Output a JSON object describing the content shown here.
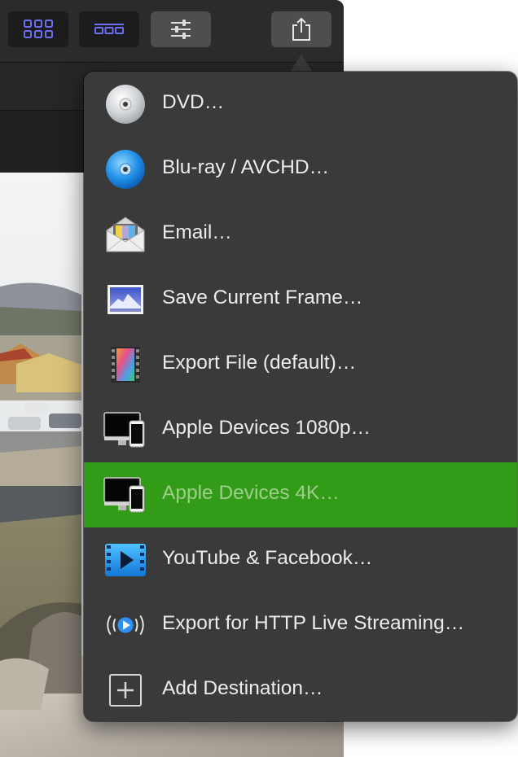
{
  "share_menu": {
    "items": [
      {
        "label": "DVD…",
        "icon": "dvd-disc-icon"
      },
      {
        "label": "Blu-ray / AVCHD…",
        "icon": "bluray-disc-icon"
      },
      {
        "label": "Email…",
        "icon": "email-envelope-icon"
      },
      {
        "label": "Save Current Frame…",
        "icon": "image-frame-icon"
      },
      {
        "label": "Export File (default)…",
        "icon": "film-strip-icon"
      },
      {
        "label": "Apple Devices 1080p…",
        "icon": "apple-devices-icon"
      },
      {
        "label": "Apple Devices 4K…",
        "icon": "apple-devices-icon",
        "selected": true
      },
      {
        "label": "YouTube & Facebook…",
        "icon": "video-play-icon"
      },
      {
        "label": "Export for HTTP Live Streaming…",
        "icon": "live-streaming-icon"
      },
      {
        "label": "Add Destination…",
        "icon": "add-destination-icon"
      }
    ]
  },
  "colors": {
    "selection": "#329b18",
    "popover_bg": "#3a3a3a",
    "toolbar_accent": "#6e6ef5"
  }
}
